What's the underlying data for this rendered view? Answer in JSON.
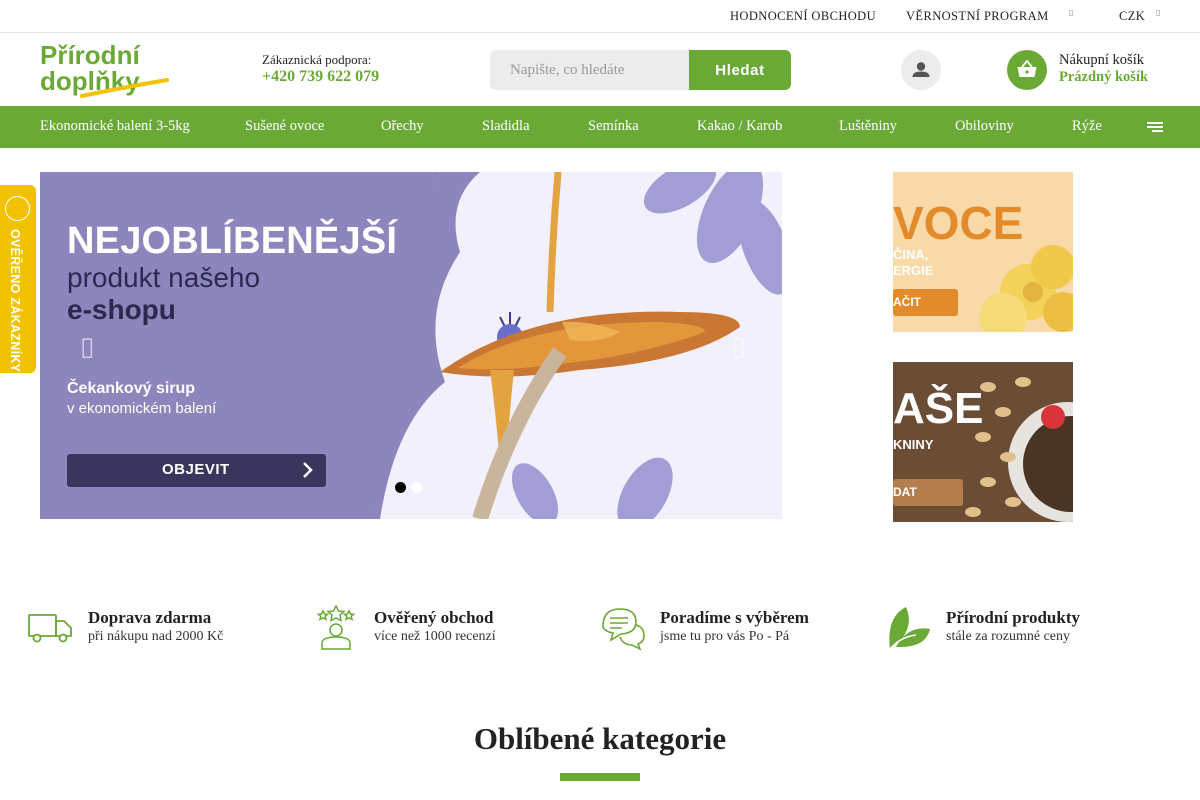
{
  "colors": {
    "brand_green": "#6aa936",
    "accent_yellow": "#f2c200",
    "hero_purple": "#8d86bd",
    "dark_text": "#222222"
  },
  "topbar": {
    "links": [
      "HODNOCENÍ OBCHODU",
      "VĚRNOSTNÍ PROGRAM"
    ],
    "currency": "CZK"
  },
  "header": {
    "logo_line1": "Přírodní",
    "logo_line2": "doplňky",
    "support_label": "Zákaznická podpora:",
    "support_phone": "+420 739 622 079",
    "search_placeholder": "Napište, co hledáte",
    "search_button": "Hledat",
    "user_icon": "user-icon",
    "cart_icon": "basket-icon",
    "cart_label": "Nákupní košík",
    "cart_status": "Prázdný košík"
  },
  "nav": {
    "items": [
      "Ekonomické balení 3-5kg",
      "Sušené ovoce",
      "Ořechy",
      "Sladidla",
      "Semínka",
      "Kakao / Karob",
      "Luštěniny",
      "Obiloviny",
      "Rýže"
    ],
    "menu_icon": "hamburger-icon"
  },
  "verified_tab": {
    "label": "OVĚŘENO ZÁKAZNÍKY"
  },
  "hero": {
    "headline": "NEJOBLÍBENĚJŠÍ",
    "line2": "produkt našeho",
    "line3": "e-shopu",
    "product_name": "Čekankový sirup",
    "product_desc": "v ekonomickém balení",
    "cta": "OBJEVIT",
    "prev_icon": "chevron-left-icon",
    "next_icon": "chevron-right-icon",
    "slides_total": 2,
    "active_slide": 1
  },
  "side_banners": [
    {
      "title": "VOCE",
      "sub1": "ČINA,",
      "sub2": "ERGIE",
      "cta": "AČIT"
    },
    {
      "title": "AŠE",
      "sub1": "KNINY",
      "cta": "DAT"
    }
  ],
  "benefits": [
    {
      "icon": "truck-icon",
      "title": "Doprava zdarma",
      "subtitle": "při nákupu nad 2000 Kč"
    },
    {
      "icon": "verified-stars-icon",
      "title": "Ověřený obchod",
      "subtitle": "více než 1000 recenzí"
    },
    {
      "icon": "chat-bubbles-icon",
      "title": "Poradíme s výběrem",
      "subtitle": "jsme tu pro vás Po - Pá"
    },
    {
      "icon": "leaf-icon",
      "title": "Přírodní produkty",
      "subtitle": "stále za rozumné ceny"
    }
  ],
  "section": {
    "title": "Oblíbené kategorie"
  }
}
